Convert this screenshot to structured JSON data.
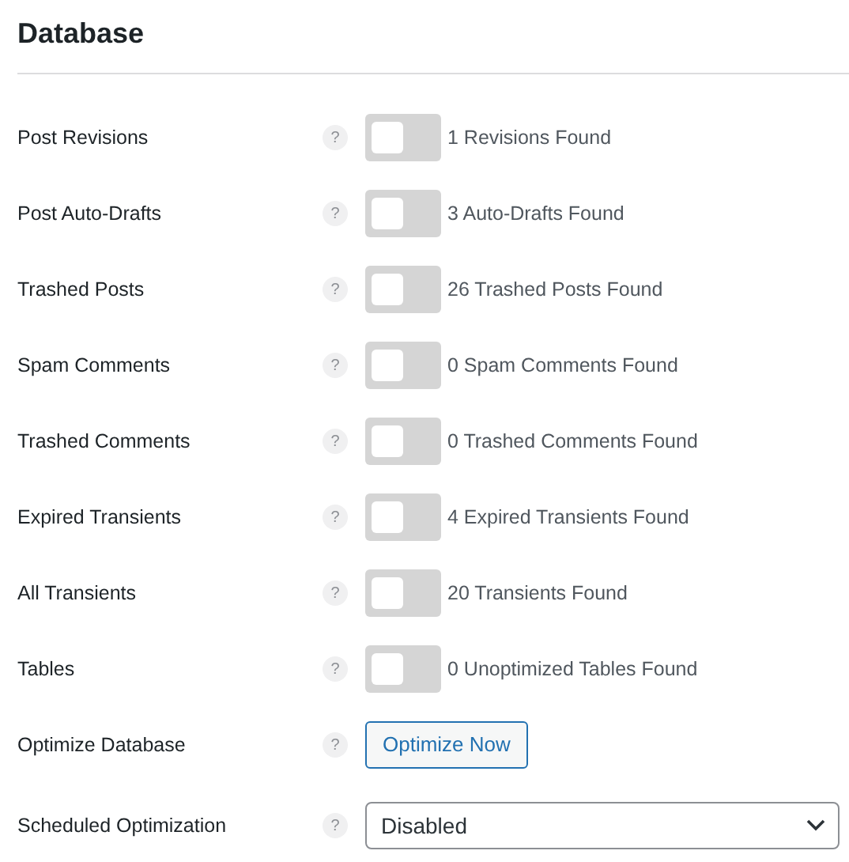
{
  "title": "Database",
  "rows": [
    {
      "kind": "toggle",
      "label": "Post Revisions",
      "help": "?",
      "on": false,
      "note": "1 Revisions Found"
    },
    {
      "kind": "toggle",
      "label": "Post Auto-Drafts",
      "help": "?",
      "on": false,
      "note": "3 Auto-Drafts Found"
    },
    {
      "kind": "toggle",
      "label": "Trashed Posts",
      "help": "?",
      "on": false,
      "note": "26 Trashed Posts Found"
    },
    {
      "kind": "toggle",
      "label": "Spam Comments",
      "help": "?",
      "on": false,
      "note": "0 Spam Comments Found"
    },
    {
      "kind": "toggle",
      "label": "Trashed Comments",
      "help": "?",
      "on": false,
      "note": "0 Trashed Comments Found"
    },
    {
      "kind": "toggle",
      "label": "Expired Transients",
      "help": "?",
      "on": false,
      "note": "4 Expired Transients Found"
    },
    {
      "kind": "toggle",
      "label": "All Transients",
      "help": "?",
      "on": false,
      "note": "20 Transients Found"
    },
    {
      "kind": "toggle",
      "label": "Tables",
      "help": "?",
      "on": false,
      "note": "0 Unoptimized Tables Found"
    },
    {
      "kind": "button",
      "label": "Optimize Database",
      "help": "?",
      "button": "Optimize Now"
    },
    {
      "kind": "select",
      "label": "Scheduled Optimization",
      "help": "?",
      "value": "Disabled"
    }
  ]
}
